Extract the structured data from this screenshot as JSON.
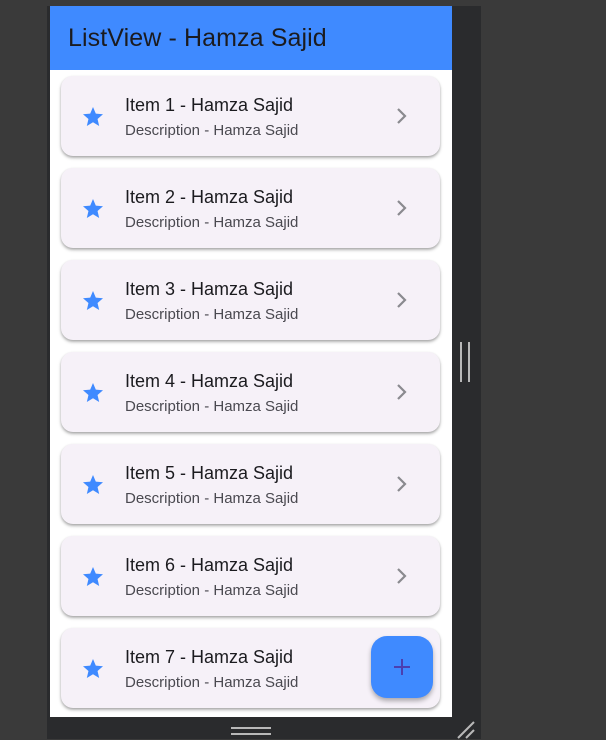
{
  "app_bar": {
    "title": "ListView - Hamza Sajid",
    "color": "#3f8aff"
  },
  "list": {
    "items": [
      {
        "title": "Item 1 - Hamza Sajid",
        "description": "Description - Hamza Sajid",
        "leading_icon": "star-icon",
        "trailing_icon": "chevron-right-icon"
      },
      {
        "title": "Item 2 - Hamza Sajid",
        "description": "Description - Hamza Sajid",
        "leading_icon": "star-icon",
        "trailing_icon": "chevron-right-icon"
      },
      {
        "title": "Item 3 - Hamza Sajid",
        "description": "Description - Hamza Sajid",
        "leading_icon": "star-icon",
        "trailing_icon": "chevron-right-icon"
      },
      {
        "title": "Item 4 - Hamza Sajid",
        "description": "Description - Hamza Sajid",
        "leading_icon": "star-icon",
        "trailing_icon": "chevron-right-icon"
      },
      {
        "title": "Item 5 - Hamza Sajid",
        "description": "Description - Hamza Sajid",
        "leading_icon": "star-icon",
        "trailing_icon": "chevron-right-icon"
      },
      {
        "title": "Item 6 - Hamza Sajid",
        "description": "Description - Hamza Sajid",
        "leading_icon": "star-icon",
        "trailing_icon": "chevron-right-icon"
      },
      {
        "title": "Item 7 - Hamza Sajid",
        "description": "Description - Hamza Sajid",
        "leading_icon": "star-icon",
        "trailing_icon": "chevron-right-icon"
      }
    ]
  },
  "fab": {
    "icon": "plus-icon",
    "color": "#3f8aff"
  },
  "colors": {
    "accent": "#3f8aff",
    "card_background": "#f6f1f8",
    "star": "#3f8aff",
    "chevron": "#8a8a8f",
    "fab_icon": "#4b3fb0"
  }
}
